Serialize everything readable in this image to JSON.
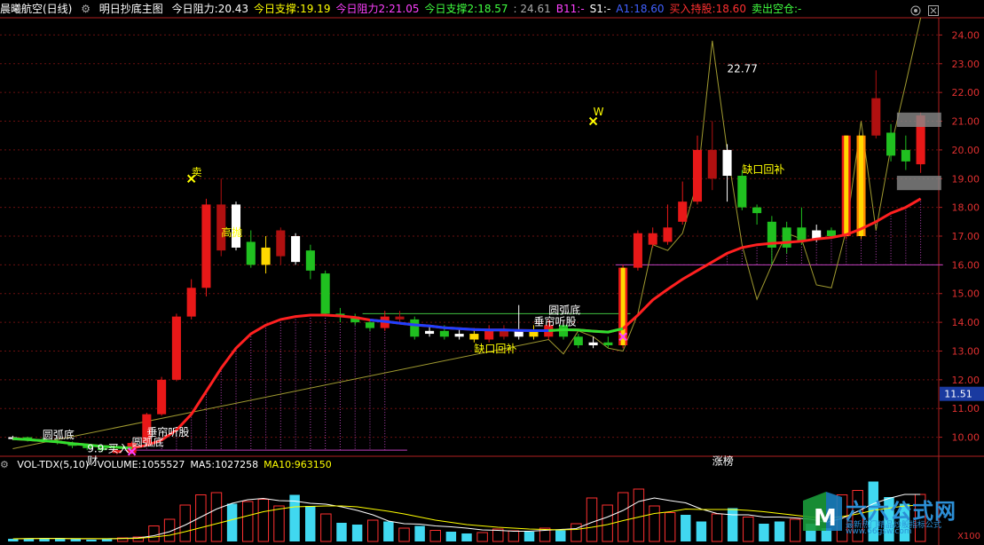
{
  "header": {
    "stock_name": "晨曦航空(日线)",
    "indicator_name": "明日抄底主图",
    "items": [
      {
        "label": "今日阻力:",
        "value": "20.43",
        "color": "#ffffff"
      },
      {
        "label": "今日支撑:",
        "value": "19.19",
        "color": "#ffff00"
      },
      {
        "label": "今日阻力2:",
        "value": "21.05",
        "color": "#ff40ff"
      },
      {
        "label": "今日支撑2:",
        "value": "18.57",
        "color": "#40ff40"
      },
      {
        "label": "",
        "value": ": 24.61",
        "color": "#aaaaaa"
      },
      {
        "label": "B11:",
        "value": "-",
        "color": "#ff40ff"
      },
      {
        "label": "S1:",
        "value": "-",
        "color": "#ffffff"
      },
      {
        "label": "A1:",
        "value": "18.60",
        "color": "#4060ff"
      },
      {
        "label": "买入持股:",
        "value": "18.60",
        "color": "#ff3030"
      },
      {
        "label": "卖出空仓:",
        "value": "-",
        "color": "#40ff40"
      }
    ]
  },
  "volume_header": {
    "indicator_name": "VOL-TDX(5,10)",
    "items": [
      {
        "label": "VOLUME:",
        "value": "1055527",
        "color": "#ffffff"
      },
      {
        "label": "MA5:",
        "value": "1027258",
        "color": "#ffffff"
      },
      {
        "label": "MA10:",
        "value": "963150",
        "color": "#ffff00"
      }
    ]
  },
  "chart_data": {
    "type": "candlestick",
    "y_ticks": [
      10.0,
      11.0,
      12.0,
      13.0,
      14.0,
      15.0,
      16.0,
      17.0,
      18.0,
      19.0,
      20.0,
      21.0,
      22.0,
      23.0,
      24.0
    ],
    "y_tick_labels": [
      "10.00",
      "11.00",
      "12.00",
      "13.00",
      "14.00",
      "15.00",
      "16.00",
      "17.00",
      "18.00",
      "19.00",
      "20.00",
      "21.00",
      "22.00",
      "23.00",
      "24.00"
    ],
    "ylim": [
      9.4,
      24.6
    ],
    "current_price_label": "11.51",
    "current_price": 11.51,
    "candles": [
      {
        "o": 9.95,
        "c": 10.0,
        "h": 10.05,
        "l": 9.9,
        "t": "w"
      },
      {
        "o": 10.0,
        "c": 9.93,
        "h": 10.02,
        "l": 9.85,
        "t": "g"
      },
      {
        "o": 9.93,
        "c": 9.88,
        "h": 9.98,
        "l": 9.82,
        "t": "g"
      },
      {
        "o": 9.88,
        "c": 9.8,
        "h": 9.95,
        "l": 9.75,
        "t": "g"
      },
      {
        "o": 9.8,
        "c": 9.7,
        "h": 9.85,
        "l": 9.62,
        "t": "g"
      },
      {
        "o": 9.7,
        "c": 9.62,
        "h": 9.75,
        "l": 9.55,
        "t": "g"
      },
      {
        "o": 9.62,
        "c": 9.55,
        "h": 9.68,
        "l": 9.48,
        "t": "g"
      },
      {
        "o": 9.55,
        "c": 9.45,
        "h": 9.6,
        "l": 9.4,
        "t": "r"
      },
      {
        "o": 9.45,
        "c": 9.8,
        "h": 9.85,
        "l": 9.4,
        "t": "r"
      },
      {
        "o": 9.8,
        "c": 10.8,
        "h": 10.85,
        "l": 9.75,
        "t": "r"
      },
      {
        "o": 10.8,
        "c": 12.0,
        "h": 12.1,
        "l": 10.75,
        "t": "r"
      },
      {
        "o": 12.0,
        "c": 14.2,
        "h": 14.3,
        "l": 11.95,
        "t": "r"
      },
      {
        "o": 14.2,
        "c": 15.2,
        "h": 15.5,
        "l": 14.1,
        "t": "r"
      },
      {
        "o": 15.2,
        "c": 18.1,
        "h": 18.3,
        "l": 14.9,
        "t": "r"
      },
      {
        "o": 18.1,
        "c": 16.5,
        "h": 19.0,
        "l": 16.3,
        "t": "dr"
      },
      {
        "o": 18.1,
        "c": 16.6,
        "h": 18.2,
        "l": 16.5,
        "t": "w"
      },
      {
        "o": 16.8,
        "c": 16.0,
        "h": 17.2,
        "l": 15.9,
        "t": "g"
      },
      {
        "o": 16.6,
        "c": 16.0,
        "h": 17.0,
        "l": 15.7,
        "t": "y"
      },
      {
        "o": 17.2,
        "c": 16.3,
        "h": 17.3,
        "l": 16.0,
        "t": "dr"
      },
      {
        "o": 17.0,
        "c": 16.1,
        "h": 17.1,
        "l": 16.0,
        "t": "w"
      },
      {
        "o": 16.5,
        "c": 15.8,
        "h": 16.7,
        "l": 15.5,
        "t": "g"
      },
      {
        "o": 15.7,
        "c": 14.3,
        "h": 15.8,
        "l": 14.2,
        "t": "g"
      },
      {
        "o": 14.3,
        "c": 14.2,
        "h": 14.5,
        "l": 14.0,
        "t": "g"
      },
      {
        "o": 14.2,
        "c": 14.0,
        "h": 14.3,
        "l": 13.9,
        "t": "g"
      },
      {
        "o": 14.0,
        "c": 13.8,
        "h": 14.1,
        "l": 13.7,
        "t": "g"
      },
      {
        "o": 13.8,
        "c": 14.2,
        "h": 14.4,
        "l": 13.7,
        "t": "r"
      },
      {
        "o": 14.2,
        "c": 14.1,
        "h": 14.4,
        "l": 14.0,
        "t": "dr"
      },
      {
        "o": 14.1,
        "c": 13.5,
        "h": 14.2,
        "l": 13.4,
        "t": "g"
      },
      {
        "o": 13.6,
        "c": 13.7,
        "h": 13.9,
        "l": 13.5,
        "t": "w"
      },
      {
        "o": 13.7,
        "c": 13.5,
        "h": 13.9,
        "l": 13.4,
        "t": "g"
      },
      {
        "o": 13.5,
        "c": 13.6,
        "h": 13.8,
        "l": 13.4,
        "t": "w"
      },
      {
        "o": 13.6,
        "c": 13.4,
        "h": 13.8,
        "l": 13.3,
        "t": "y"
      },
      {
        "o": 13.4,
        "c": 13.7,
        "h": 13.9,
        "l": 13.3,
        "t": "r"
      },
      {
        "o": 13.7,
        "c": 13.5,
        "h": 13.9,
        "l": 13.4,
        "t": "dr"
      },
      {
        "o": 13.5,
        "c": 13.7,
        "h": 14.6,
        "l": 13.4,
        "t": "w"
      },
      {
        "o": 13.7,
        "c": 13.5,
        "h": 13.9,
        "l": 13.4,
        "t": "y"
      },
      {
        "o": 13.5,
        "c": 13.9,
        "h": 14.1,
        "l": 13.4,
        "t": "r"
      },
      {
        "o": 13.9,
        "c": 13.5,
        "h": 14.0,
        "l": 13.4,
        "t": "g"
      },
      {
        "o": 13.5,
        "c": 13.2,
        "h": 13.6,
        "l": 13.1,
        "t": "g"
      },
      {
        "o": 13.2,
        "c": 13.3,
        "h": 13.5,
        "l": 13.1,
        "t": "w"
      },
      {
        "o": 13.3,
        "c": 13.2,
        "h": 13.5,
        "l": 13.1,
        "t": "g"
      },
      {
        "o": 13.2,
        "c": 15.9,
        "h": 16.0,
        "l": 13.1,
        "t": "rb"
      },
      {
        "o": 15.9,
        "c": 17.1,
        "h": 17.2,
        "l": 15.8,
        "t": "r"
      },
      {
        "o": 17.1,
        "c": 16.7,
        "h": 17.3,
        "l": 16.6,
        "t": "r"
      },
      {
        "o": 16.8,
        "c": 17.3,
        "h": 18.1,
        "l": 16.7,
        "t": "r"
      },
      {
        "o": 17.5,
        "c": 18.2,
        "h": 18.9,
        "l": 17.4,
        "t": "r"
      },
      {
        "o": 18.2,
        "c": 20.0,
        "h": 20.5,
        "l": 18.1,
        "t": "r"
      },
      {
        "o": 20.0,
        "c": 19.0,
        "h": 21.0,
        "l": 18.6,
        "t": "dr"
      },
      {
        "o": 20.0,
        "c": 19.1,
        "h": 20.2,
        "l": 18.2,
        "t": "w"
      },
      {
        "o": 19.1,
        "c": 18.0,
        "h": 19.3,
        "l": 17.9,
        "t": "g"
      },
      {
        "o": 18.0,
        "c": 17.8,
        "h": 18.1,
        "l": 17.4,
        "t": "g"
      },
      {
        "o": 17.5,
        "c": 16.6,
        "h": 17.7,
        "l": 16.0,
        "t": "g"
      },
      {
        "o": 16.6,
        "c": 17.3,
        "h": 17.5,
        "l": 16.4,
        "t": "g"
      },
      {
        "o": 17.3,
        "c": 16.8,
        "h": 18.0,
        "l": 16.7,
        "t": "g"
      },
      {
        "o": 16.9,
        "c": 17.2,
        "h": 17.4,
        "l": 16.8,
        "t": "w"
      },
      {
        "o": 17.2,
        "c": 17.0,
        "h": 17.3,
        "l": 16.9,
        "t": "g"
      },
      {
        "o": 17.0,
        "c": 20.5,
        "h": 20.5,
        "l": 16.9,
        "t": "rb"
      },
      {
        "o": 17.0,
        "c": 20.5,
        "h": 20.5,
        "l": 16.9,
        "t": "ob"
      },
      {
        "o": 20.5,
        "c": 21.8,
        "h": 22.77,
        "l": 20.4,
        "t": "dr"
      },
      {
        "o": 20.6,
        "c": 19.8,
        "h": 20.9,
        "l": 19.6,
        "t": "g"
      },
      {
        "o": 20.0,
        "c": 19.6,
        "h": 20.5,
        "l": 19.3,
        "t": "g"
      },
      {
        "o": 19.5,
        "c": 21.2,
        "h": 21.3,
        "l": 19.2,
        "t": "r"
      }
    ],
    "ma_line": [
      9.95,
      9.92,
      9.88,
      9.84,
      9.78,
      9.73,
      9.68,
      9.65,
      9.62,
      9.72,
      9.9,
      10.25,
      10.8,
      11.6,
      12.4,
      13.1,
      13.6,
      13.9,
      14.1,
      14.2,
      14.25,
      14.25,
      14.22,
      14.17,
      14.08,
      14.03,
      13.97,
      13.91,
      13.87,
      13.81,
      13.78,
      13.75,
      13.73,
      13.73,
      13.72,
      13.71,
      13.71,
      13.74,
      13.73,
      13.69,
      13.66,
      13.78,
      14.25,
      14.78,
      15.15,
      15.5,
      15.8,
      16.1,
      16.4,
      16.6,
      16.7,
      16.75,
      16.78,
      16.82,
      16.9,
      16.95,
      17.05,
      17.25,
      17.5,
      17.8,
      18.0,
      18.3
    ],
    "ma_line_blue_segment": [
      24,
      36
    ],
    "ma_line_green_segments": [
      [
        0,
        8
      ],
      [
        36,
        41
      ]
    ],
    "thin_line": [
      9.6,
      null,
      null,
      null,
      null,
      null,
      null,
      null,
      null,
      null,
      null,
      null,
      null,
      null,
      null,
      null,
      null,
      null,
      null,
      null,
      null,
      null,
      null,
      null,
      null,
      null,
      null,
      null,
      null,
      null,
      null,
      null,
      null,
      null,
      null,
      null,
      13.4,
      12.9,
      13.7,
      13.5,
      13.1,
      13.0,
      14.3,
      16.7,
      16.5,
      17.1,
      18.9,
      23.8,
      20.0,
      16.7,
      14.8,
      16.0,
      17.1,
      16.9,
      15.3,
      15.2,
      17.2,
      21.0,
      17.2,
      20.1,
      22.3,
      24.6
    ],
    "h_lines": [
      {
        "y": 9.55,
        "from": 8,
        "to": 26,
        "color": "#c040c0"
      },
      {
        "y": 16.0,
        "from": 41,
        "to": 62,
        "color": "#c040c0"
      },
      {
        "y": 14.3,
        "from": 24,
        "to": 41,
        "color": "#40c040"
      }
    ],
    "annotations": [
      {
        "text": "圆弧底",
        "i": 2,
        "y": 9.95,
        "color": "#ffffff"
      },
      {
        "text": "圆弧底",
        "i": 8,
        "y": 9.7,
        "color": "#ffffff"
      },
      {
        "text": "垂帘听股",
        "i": 9,
        "y": 10.05,
        "color": "#ffffff"
      },
      {
        "text": "9.9-买入",
        "i": 5,
        "y": 9.47,
        "color": "#ffffff"
      },
      {
        "text": "财",
        "i": 5,
        "y": 9.05,
        "color": "#ffffff"
      },
      {
        "text": "卖",
        "i": 12,
        "y": 19.1,
        "color": "#ffff00"
      },
      {
        "text": "高抛",
        "i": 14,
        "y": 17.0,
        "color": "#ffff00"
      },
      {
        "text": "缺口回补",
        "i": 31,
        "y": 12.95,
        "color": "#ffff00"
      },
      {
        "text": "垂帘听股",
        "i": 35,
        "y": 13.9,
        "color": "#ffffff"
      },
      {
        "text": "圆弧底",
        "i": 36,
        "y": 14.3,
        "color": "#ffffff"
      },
      {
        "text": "W",
        "i": 39,
        "y": 21.2,
        "color": "#ffff00"
      },
      {
        "text": "22.77",
        "i": 48,
        "y": 22.7,
        "color": "#ffffff"
      },
      {
        "text": "缺口回补",
        "i": 49,
        "y": 19.2,
        "color": "#ffff00"
      },
      {
        "text": "涨榜",
        "i": 47,
        "y": 9.05,
        "color": "#ffffff"
      }
    ],
    "volume": {
      "ylim": [
        0,
        1.5
      ],
      "bars": [
        {
          "v": 0.06,
          "t": "g"
        },
        {
          "v": 0.07,
          "t": "g"
        },
        {
          "v": 0.07,
          "t": "g"
        },
        {
          "v": 0.06,
          "t": "g"
        },
        {
          "v": 0.05,
          "t": "g"
        },
        {
          "v": 0.04,
          "t": "g"
        },
        {
          "v": 0.05,
          "t": "g"
        },
        {
          "v": 0.08,
          "t": "r"
        },
        {
          "v": 0.1,
          "t": "r"
        },
        {
          "v": 0.35,
          "t": "r"
        },
        {
          "v": 0.5,
          "t": "r"
        },
        {
          "v": 0.82,
          "t": "r"
        },
        {
          "v": 1.05,
          "t": "r"
        },
        {
          "v": 1.1,
          "t": "r"
        },
        {
          "v": 0.85,
          "t": "g"
        },
        {
          "v": 0.9,
          "t": "r"
        },
        {
          "v": 0.95,
          "t": "r"
        },
        {
          "v": 0.8,
          "t": "r"
        },
        {
          "v": 1.05,
          "t": "g"
        },
        {
          "v": 0.8,
          "t": "g"
        },
        {
          "v": 0.62,
          "t": "r"
        },
        {
          "v": 0.42,
          "t": "g"
        },
        {
          "v": 0.38,
          "t": "g"
        },
        {
          "v": 0.48,
          "t": "r"
        },
        {
          "v": 0.45,
          "t": "g"
        },
        {
          "v": 0.3,
          "t": "r"
        },
        {
          "v": 0.35,
          "t": "g"
        },
        {
          "v": 0.25,
          "t": "r"
        },
        {
          "v": 0.22,
          "t": "g"
        },
        {
          "v": 0.18,
          "t": "g"
        },
        {
          "v": 0.2,
          "t": "r"
        },
        {
          "v": 0.28,
          "t": "r"
        },
        {
          "v": 0.24,
          "t": "r"
        },
        {
          "v": 0.22,
          "t": "g"
        },
        {
          "v": 0.3,
          "t": "r"
        },
        {
          "v": 0.25,
          "t": "g"
        },
        {
          "v": 0.4,
          "t": "r"
        },
        {
          "v": 0.98,
          "t": "r"
        },
        {
          "v": 0.82,
          "t": "r"
        },
        {
          "v": 1.1,
          "t": "r"
        },
        {
          "v": 1.18,
          "t": "r"
        },
        {
          "v": 0.8,
          "t": "r"
        },
        {
          "v": 0.65,
          "t": "r"
        },
        {
          "v": 0.6,
          "t": "g"
        },
        {
          "v": 0.45,
          "t": "g"
        },
        {
          "v": 0.62,
          "t": "r"
        },
        {
          "v": 0.75,
          "t": "g"
        },
        {
          "v": 0.55,
          "t": "r"
        },
        {
          "v": 0.4,
          "t": "g"
        },
        {
          "v": 0.45,
          "t": "g"
        },
        {
          "v": 0.5,
          "t": "r"
        },
        {
          "v": 0.4,
          "t": "g"
        },
        {
          "v": 0.3,
          "t": "g"
        },
        {
          "v": 1.05,
          "t": "r"
        },
        {
          "v": 1.15,
          "t": "r"
        },
        {
          "v": 1.35,
          "t": "g"
        },
        {
          "v": 1.0,
          "t": "g"
        },
        {
          "v": 0.85,
          "t": "g"
        },
        {
          "v": 1.06,
          "t": "r"
        }
      ],
      "ma5": [
        0.06,
        0.065,
        0.07,
        0.07,
        0.06,
        0.06,
        0.06,
        0.07,
        0.08,
        0.13,
        0.22,
        0.37,
        0.55,
        0.73,
        0.86,
        0.94,
        0.97,
        0.92,
        0.91,
        0.86,
        0.84,
        0.78,
        0.7,
        0.6,
        0.46,
        0.4,
        0.39,
        0.35,
        0.33,
        0.3,
        0.26,
        0.25,
        0.23,
        0.23,
        0.25,
        0.27,
        0.29,
        0.43,
        0.55,
        0.7,
        0.9,
        0.98,
        0.92,
        0.87,
        0.73,
        0.63,
        0.6,
        0.6,
        0.55,
        0.55,
        0.53,
        0.5,
        0.43,
        0.52,
        0.68,
        0.85,
        0.97,
        1.06,
        1.06
      ],
      "ma10": [
        0.06,
        0.065,
        0.065,
        0.065,
        0.065,
        0.065,
        0.063,
        0.065,
        0.07,
        0.1,
        0.14,
        0.22,
        0.31,
        0.4,
        0.49,
        0.58,
        0.67,
        0.73,
        0.78,
        0.79,
        0.8,
        0.8,
        0.78,
        0.73,
        0.68,
        0.62,
        0.55,
        0.48,
        0.43,
        0.38,
        0.35,
        0.32,
        0.3,
        0.28,
        0.27,
        0.26,
        0.27,
        0.32,
        0.38,
        0.47,
        0.55,
        0.63,
        0.67,
        0.73,
        0.72,
        0.72,
        0.72,
        0.7,
        0.67,
        0.63,
        0.59,
        0.55,
        0.52,
        0.56,
        0.62,
        0.7,
        0.75,
        0.8,
        0.82
      ]
    }
  },
  "watermark": {
    "text": "六六公式网",
    "sub": "最新热门精品炒股指标公式",
    "url": "www.66gsw.com",
    "logo_letter": "M"
  },
  "y_axis_unit_label": "X100"
}
